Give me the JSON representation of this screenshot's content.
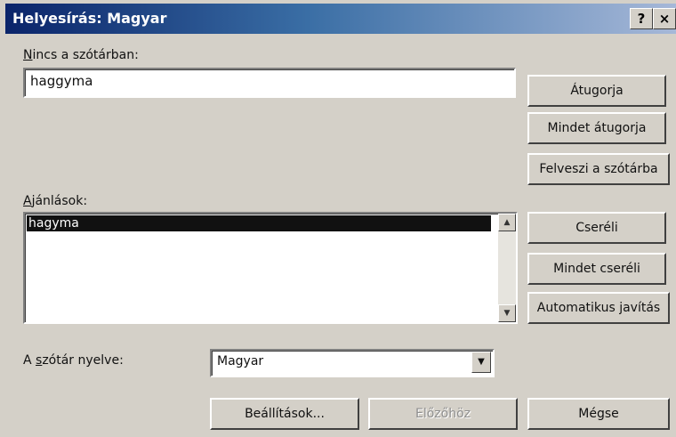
{
  "dialog": {
    "title": "Helyesírás: Magyar",
    "help_glyph": "?",
    "close_glyph": "×"
  },
  "not_in_dictionary": {
    "label_first": "N",
    "label_rest": "incs a szótárban:",
    "value": "haggyma"
  },
  "suggestions": {
    "label_first": "A",
    "label_rest": "jánlások:",
    "items": [
      "hagyma"
    ],
    "selected_index": 0
  },
  "dictionary_language": {
    "label_pre": "A ",
    "label_ul": "s",
    "label_post": "zótár nyelve:",
    "value": "Magyar"
  },
  "buttons": {
    "ignore": "Átugorja",
    "ignore_all": "Mindet átugorja",
    "add": "Felveszi a szótárba",
    "change": "Cseréli",
    "change_all": "Mindet cseréli",
    "autocorrect": "Automatikus javítás",
    "options": "Beállítások...",
    "undo": "Előzőhöz",
    "cancel": "Mégse"
  },
  "icons": {
    "scroll_up": "up-arrow-icon",
    "scroll_down": "down-arrow-icon",
    "dropdown": "down-arrow-icon"
  }
}
